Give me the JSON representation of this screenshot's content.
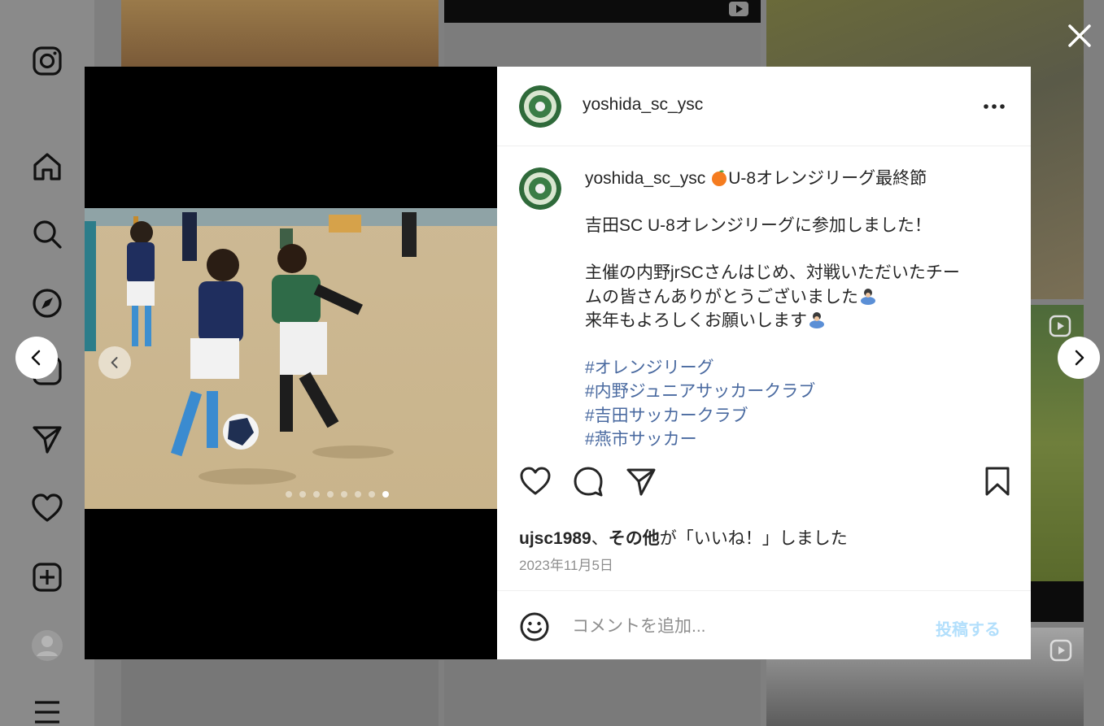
{
  "sidebar": {
    "icons": [
      "instagram-logo-icon",
      "home-icon",
      "search-icon",
      "explore-compass-icon",
      "reels-icon",
      "messages-paper-plane-icon",
      "notifications-heart-icon",
      "create-plus-icon",
      "profile-avatar",
      "menu-hamburger-icon"
    ]
  },
  "post": {
    "author": "yoshida_sc_ysc",
    "caption": {
      "username": "yoshida_sc_ysc",
      "title": "U-8オレンジリーグ最終節",
      "lines": [
        "吉田SC U-8オレンジリーグに参加しました！",
        "主催の内野jrSCさんはじめ、対戦いただいたチー",
        "ムの皆さんありがとうございました",
        "来年もよろしくお願いします"
      ],
      "hashtags": [
        "#オレンジリーグ",
        "#内野ジュニアサッカークラブ",
        "#吉田サッカークラブ",
        "#燕市サッカー"
      ]
    },
    "likes": {
      "user": "ujsc1989",
      "separator": "、",
      "others": "その他",
      "suffix": "が「いいね！」しました"
    },
    "date": "2023年11月5日",
    "carousel": {
      "total": 8,
      "active_index": 7
    }
  },
  "comment": {
    "placeholder": "コメントを追加...",
    "post_label": "投稿する"
  },
  "colors": {
    "hashtag": "#4a6aa0",
    "post_button_disabled": "#b2dffc",
    "overlay": "#7f7f7f"
  }
}
